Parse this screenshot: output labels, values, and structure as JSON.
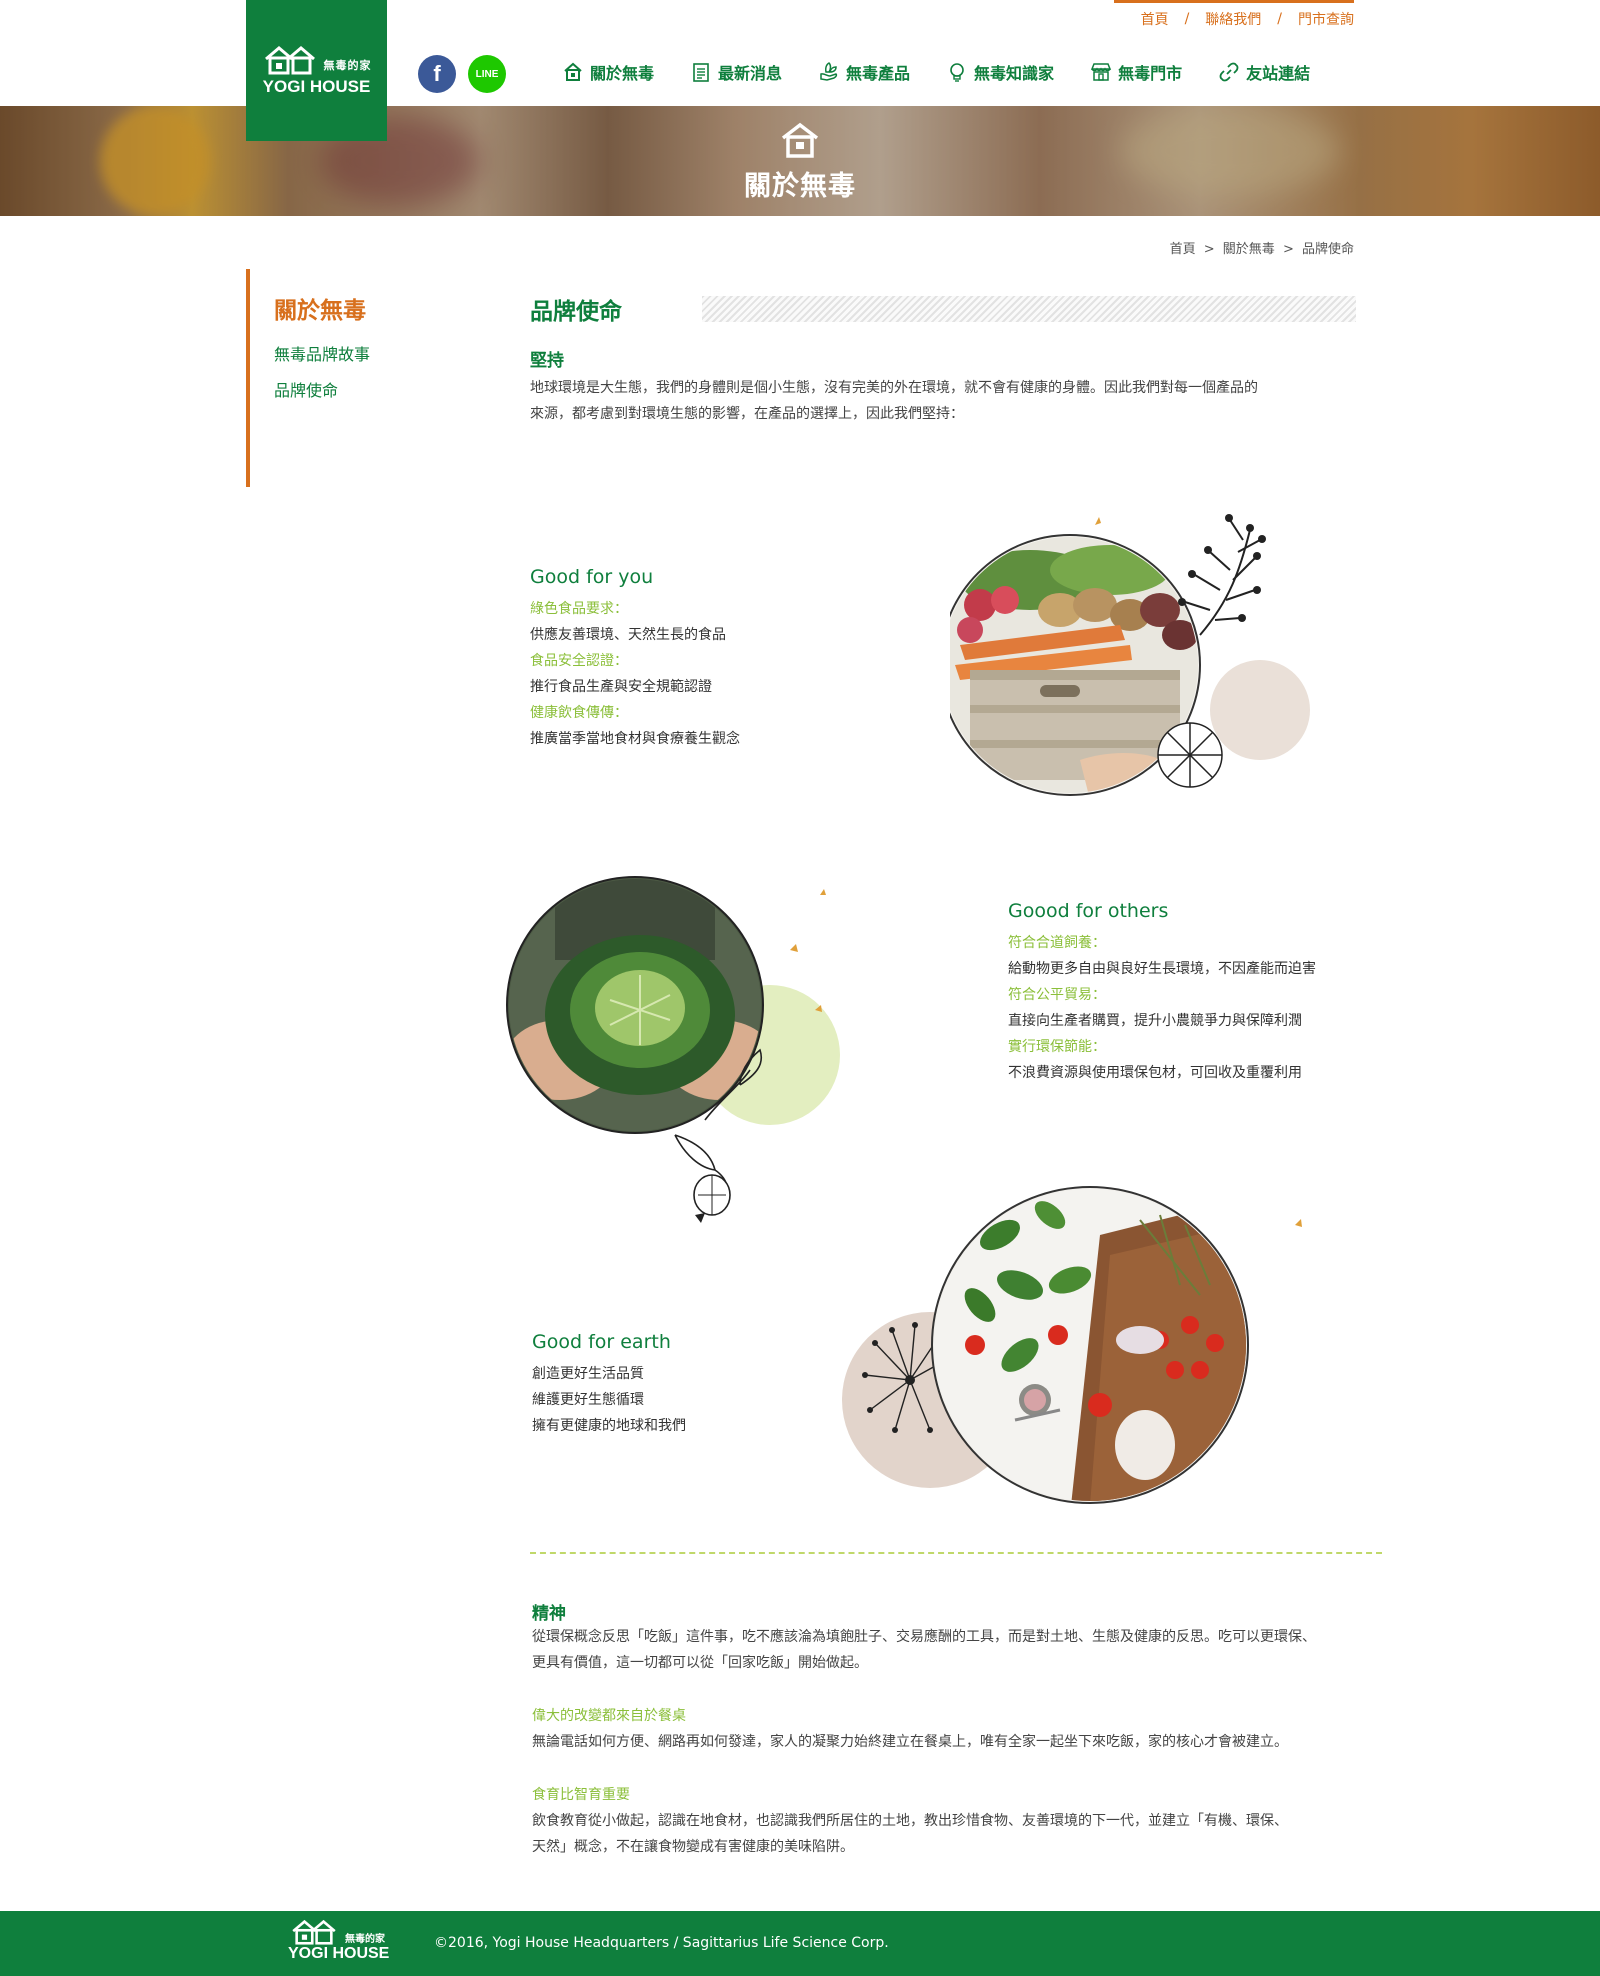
{
  "header": {
    "logo_cn": "無毒的家",
    "logo_en": "YOGI HOUSE",
    "top_links": [
      "首頁",
      "聯絡我們",
      "門市查詢"
    ],
    "top_sep": "/",
    "social": {
      "facebook_label": "f",
      "line_label": "LINE"
    },
    "nav": [
      {
        "label": "關於無毒",
        "icon": "house-icon"
      },
      {
        "label": "最新消息",
        "icon": "document-icon"
      },
      {
        "label": "無毒產品",
        "icon": "hand-leaf-icon"
      },
      {
        "label": "無毒知識家",
        "icon": "lightbulb-icon"
      },
      {
        "label": "無毒門市",
        "icon": "store-icon"
      },
      {
        "label": "友站連結",
        "icon": "link-icon"
      }
    ]
  },
  "banner": {
    "title": "關於無毒"
  },
  "breadcrumb": {
    "items": [
      "首頁",
      "關於無毒",
      "品牌使命"
    ],
    "sep": ">"
  },
  "sidebar": {
    "title": "關於無毒",
    "items": [
      "無毒品牌故事",
      "品牌使命"
    ]
  },
  "main": {
    "title": "品牌使命",
    "persist_heading": "堅持",
    "persist_text_1": "地球環境是大生態，我們的身體則是個小生態，沒有完美的外在環境，就不會有健康的身體。因此我們對每一個產品的",
    "persist_text_2": "來源，都考慮到對環境生態的影響，在產品的選擇上，因此我們堅持：",
    "good_for_you": {
      "title": "Good for you",
      "items": [
        {
          "label": "綠色食品要求：",
          "text": "供應友善環境、天然生長的食品"
        },
        {
          "label": "食品安全認證：",
          "text": "推行食品生產與安全規範認證"
        },
        {
          "label": "健康飲食傳傳：",
          "text": "推廣當季當地食材與食療養生觀念"
        }
      ]
    },
    "good_for_others": {
      "title": "Goood for others",
      "items": [
        {
          "label": "符合合道飼養：",
          "text": "給動物更多自由與良好生長環境，不因產能而迫害"
        },
        {
          "label": "符合公平貿易：",
          "text": "直接向生產者購買，提升小農競爭力與保障利潤"
        },
        {
          "label": "實行環保節能：",
          "text": "不浪費資源與使用環保包材，可回收及重覆利用"
        }
      ]
    },
    "good_for_earth": {
      "title": "Good for earth",
      "lines": [
        "創造更好生活品質",
        "維護更好生態循環",
        "擁有更健康的地球和我們"
      ]
    },
    "spirit": {
      "heading": "精神",
      "text_1": "從環保概念反思「吃飯」這件事，吃不應該淪為填飽肚子、交易應酬的工具，而是對土地、生態及健康的反思。吃可以更環保、",
      "text_2": "更具有價值，這一切都可以從「回家吃飯」開始做起。",
      "sub1_heading": "偉大的改變都來自於餐桌",
      "sub1_text": "無論電話如何方便、網路再如何發達，家人的凝聚力始終建立在餐桌上，唯有全家一起坐下來吃飯，家的核心才會被建立。",
      "sub2_heading": "食育比智育重要",
      "sub2_text_1": "飲食教育從小做起，認識在地食材，也認識我們所居住的土地，教出珍惜食物、友善環境的下一代，並建立「有機、環保、",
      "sub2_text_2": "天然」概念，不在讓食物變成有害健康的美味陷阱。"
    }
  },
  "footer": {
    "logo_cn": "無毒的家",
    "logo_en": "YOGI HOUSE",
    "copyright": "©2016, Yogi House Headquarters / Sagittarius Life Science Corp."
  },
  "colors": {
    "brand_green": "#0f7f3d",
    "accent_orange": "#d8701d",
    "label_green": "#8bbf3a"
  }
}
